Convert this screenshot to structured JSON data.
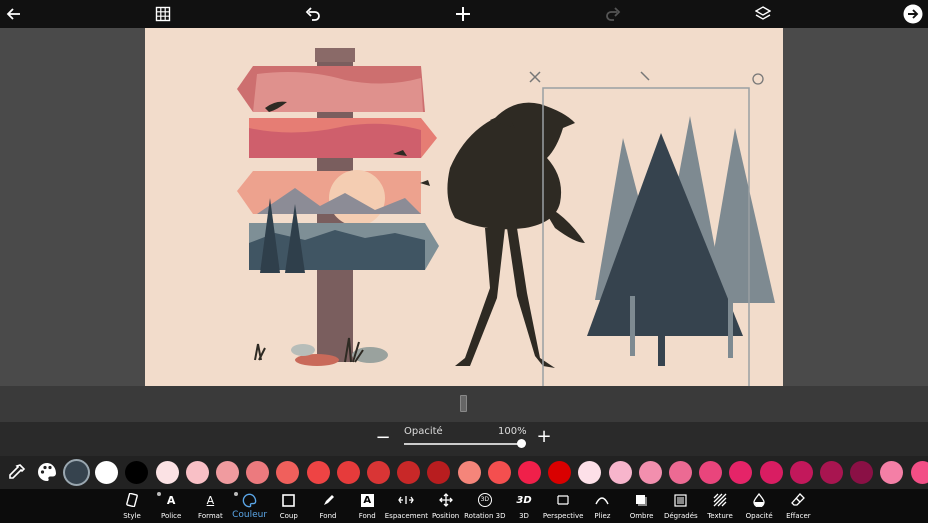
{
  "topbar": {
    "icons": [
      "back-arrow-icon",
      "grid-icon",
      "undo-icon",
      "add-icon",
      "redo-icon",
      "layers-icon",
      "next-arrow-icon"
    ]
  },
  "opacity": {
    "label": "Opacité",
    "value_text": "100%",
    "value": 1.0,
    "minus": "−",
    "plus": "+"
  },
  "swatches": {
    "selected_index": 0,
    "colors": [
      "#36434e",
      "#ffffff",
      "#000000",
      "#fbe2e4",
      "#f9c0c6",
      "#f09b9f",
      "#ec7a7e",
      "#f0605c",
      "#ee4444",
      "#e63b3b",
      "#d93535",
      "#c82828",
      "#b81d1f",
      "#f5857a",
      "#f44f4f",
      "#f0204a",
      "#d90000",
      "#fde0e8",
      "#f7b5cc",
      "#f28fae",
      "#ec6a93",
      "#e9457c",
      "#e52468",
      "#d91d62",
      "#c2185b",
      "#a81550",
      "#8a1045",
      "#f47fa6",
      "#f24f86"
    ]
  },
  "toolbar": {
    "items": [
      {
        "label": "Style",
        "icon": "style-icon"
      },
      {
        "label": "Police",
        "icon": "font-icon"
      },
      {
        "label": "Format",
        "icon": "format-icon"
      },
      {
        "label": "Couleur",
        "icon": "palette-icon",
        "active": true
      },
      {
        "label": "Coup",
        "icon": "stroke-icon"
      },
      {
        "label": "Fond",
        "icon": "fill-brush-icon"
      },
      {
        "label": "Fond",
        "icon": "background-letter-icon"
      },
      {
        "label": "Espacement",
        "icon": "spacing-icon"
      },
      {
        "label": "Position",
        "icon": "move-icon"
      },
      {
        "label": "Rotation 3D",
        "icon": "rotate-3d-icon"
      },
      {
        "label": "3D",
        "icon": "3d-icon"
      },
      {
        "label": "Perspective",
        "icon": "perspective-icon"
      },
      {
        "label": "Pliez",
        "icon": "bend-icon"
      },
      {
        "label": "Ombre",
        "icon": "shadow-icon"
      },
      {
        "label": "Dégradés",
        "icon": "gradient-icon"
      },
      {
        "label": "Texture",
        "icon": "texture-icon"
      },
      {
        "label": "Opacité",
        "icon": "opacity-icon"
      },
      {
        "label": "Effacer",
        "icon": "eraser-icon"
      }
    ],
    "icon_glyphs": {
      "rotate3d": "3D",
      "threed": "3D",
      "fond": "A"
    }
  },
  "colors": {
    "canvas_bg": "#f2dccb",
    "silhouette": "#2e2a23",
    "tree_dark": "#36434e",
    "tree_light": "#7e8a91",
    "accent": "#5aa5e6"
  }
}
